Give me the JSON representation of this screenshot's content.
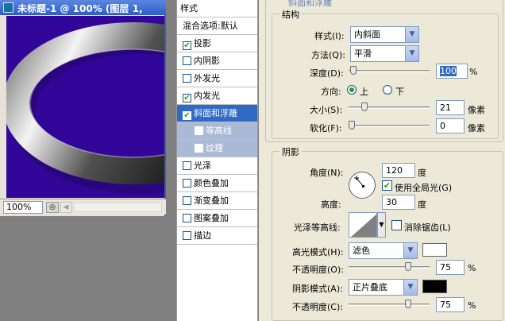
{
  "doc_window": {
    "title": "未标题-1 @ 100% (图层 1,",
    "zoom": "100%"
  },
  "style_list": {
    "items": [
      {
        "label": "样式",
        "checkbox": false,
        "checked": false,
        "state": "header"
      },
      {
        "label": "混合选项:默认",
        "checkbox": false,
        "checked": false,
        "state": "normal"
      },
      {
        "label": "投影",
        "checkbox": true,
        "checked": true,
        "state": "normal"
      },
      {
        "label": "内阴影",
        "checkbox": true,
        "checked": false,
        "state": "normal"
      },
      {
        "label": "外发光",
        "checkbox": true,
        "checked": false,
        "state": "normal"
      },
      {
        "label": "内发光",
        "checkbox": true,
        "checked": true,
        "state": "normal"
      },
      {
        "label": "斜面和浮雕",
        "checkbox": true,
        "checked": true,
        "state": "selected"
      },
      {
        "label": "等高线",
        "checkbox": true,
        "checked": false,
        "state": "sub"
      },
      {
        "label": "纹理",
        "checkbox": true,
        "checked": false,
        "state": "sub"
      },
      {
        "label": "光泽",
        "checkbox": true,
        "checked": false,
        "state": "normal"
      },
      {
        "label": "颜色叠加",
        "checkbox": true,
        "checked": false,
        "state": "normal"
      },
      {
        "label": "渐变叠加",
        "checkbox": true,
        "checked": false,
        "state": "normal"
      },
      {
        "label": "图案叠加",
        "checkbox": true,
        "checked": false,
        "state": "normal"
      },
      {
        "label": "描边",
        "checkbox": true,
        "checked": false,
        "state": "normal"
      }
    ]
  },
  "panel": {
    "section_title": "斜面和浮雕",
    "structure": {
      "title": "结构",
      "style_label": "样式(I):",
      "style_value": "内斜面",
      "technique_label": "方法(Q):",
      "technique_value": "平滑",
      "depth_label": "深度(D):",
      "depth_value": "100",
      "depth_level": 0.02,
      "depth_unit": "%",
      "direction_label": "方向:",
      "direction_up": "上",
      "direction_down": "下",
      "size_label": "大小(S):",
      "size_value": "21",
      "size_level": 0.17,
      "size_unit": "像素",
      "soften_label": "软化(F):",
      "soften_value": "0",
      "soften_level": 0,
      "soften_unit": "像素"
    },
    "shading": {
      "title": "阴影",
      "angle_label": "角度(N):",
      "angle_value": "120",
      "angle_unit": "度",
      "global_light_label": "使用全局光(G)",
      "altitude_label": "高度:",
      "altitude_value": "30",
      "altitude_unit": "度",
      "gloss_label": "光泽等高线:",
      "antialias_label": "消除锯齿(L)",
      "highlight_label": "高光模式(H):",
      "highlight_mode": "滤色",
      "highlight_color": "#ffffff",
      "highlight_opacity_label": "不透明度(O):",
      "highlight_opacity": "75",
      "highlight_opacity_level": 0.75,
      "shadow_label": "阴影模式(A):",
      "shadow_mode": "正片叠底",
      "shadow_color": "#000000",
      "shadow_opacity_label": "不透明度(C):",
      "shadow_opacity": "75",
      "shadow_opacity_level": 0.75,
      "percent": "%"
    }
  },
  "colors": {
    "canvas": "#33069a",
    "selection": "#316ac5",
    "sub_item": "#aab9d6",
    "checkmark": "#21a121"
  }
}
